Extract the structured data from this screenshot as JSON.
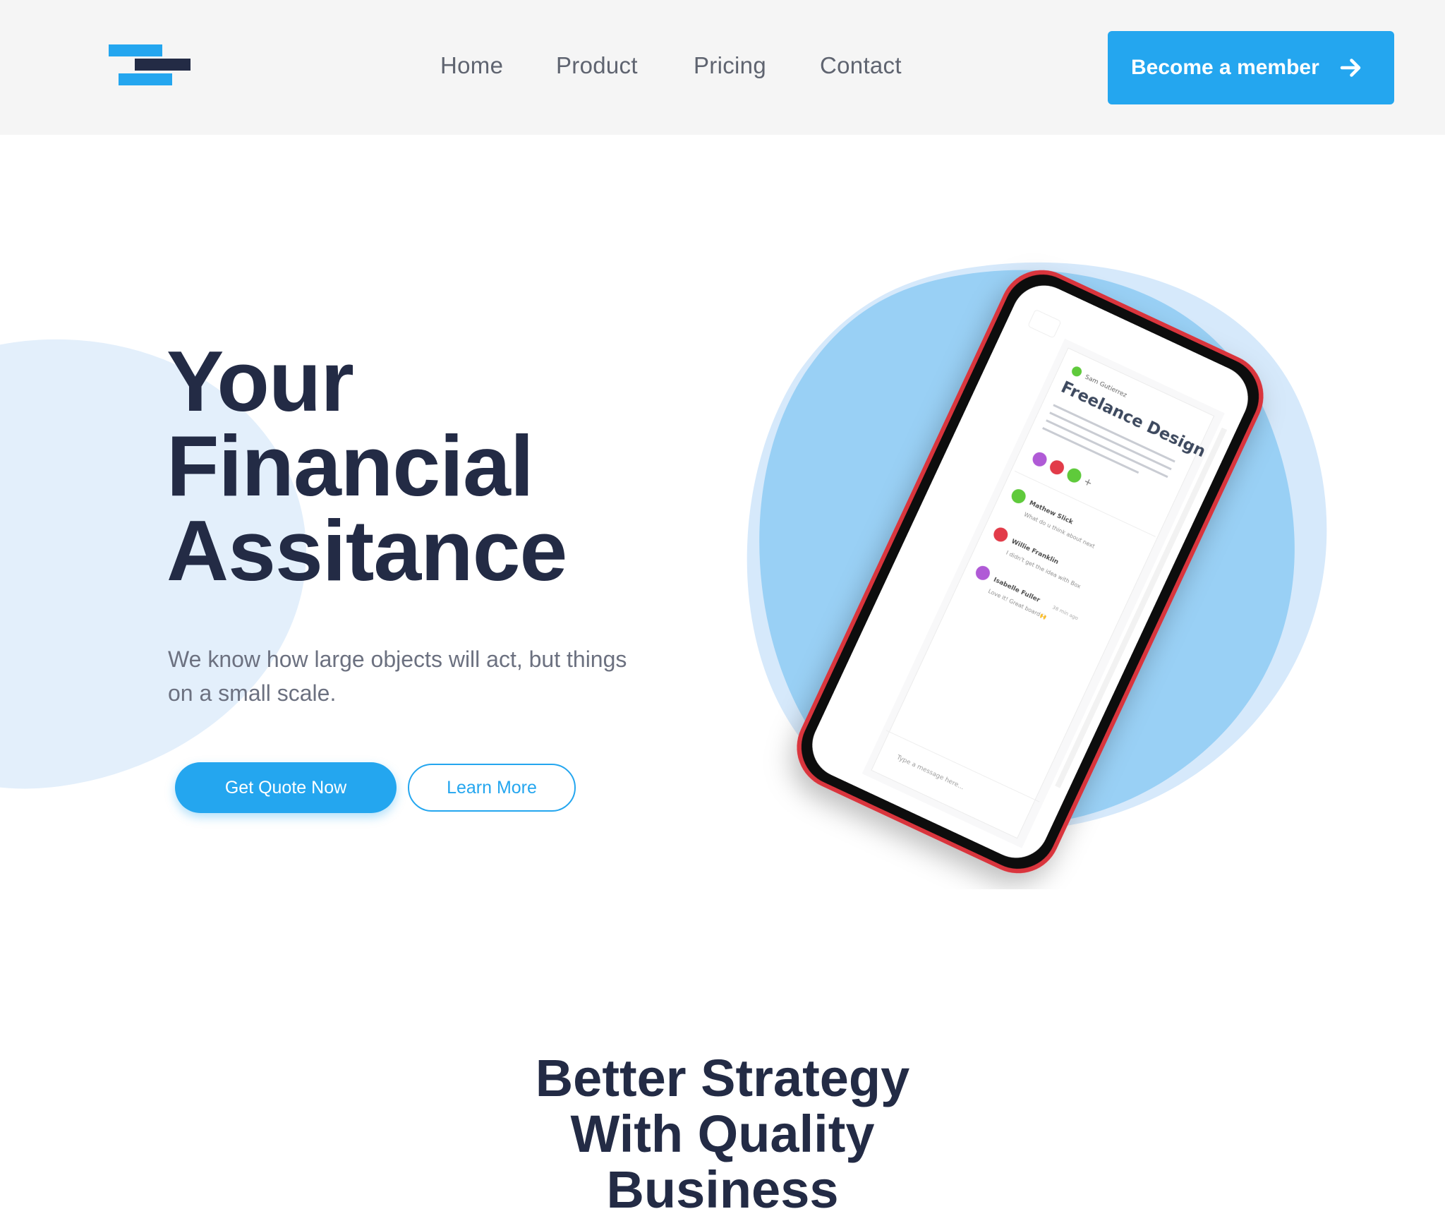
{
  "header": {
    "logo": "logo-mark",
    "nav": [
      "Home",
      "Product",
      "Pricing",
      "Contact"
    ],
    "cta_label": "Become a member",
    "cta_icon": "arrow-right-icon"
  },
  "hero": {
    "title_lines": [
      "Your",
      "Financial",
      "Assitance"
    ],
    "subtitle": "We know how large objects will act, but things on a small scale.",
    "primary_button": "Get Quote Now",
    "secondary_button": "Learn More",
    "phone_screen": {
      "user": "Sam Gutierrez",
      "card_title": "Freelance Design",
      "card_body": "Do you want to download free song for ipod? If so, reading this article could save you from getting in to a lot of trouble! Downloading music to your Ipod has become easy. This article will tell you the best way to download free",
      "comments": [
        {
          "name": "Mathew Slick",
          "text": "What do u think about next"
        },
        {
          "name": "Willie Franklin",
          "text": "I didn't get the idea with Box"
        },
        {
          "name": "Isabelle Fuller",
          "time": "38 min ago",
          "text": "Love it! Great board🙌"
        }
      ],
      "message_placeholder": "Type a message here..."
    }
  },
  "section": {
    "title_lines": [
      "Better Strategy",
      "With Quality",
      "Business"
    ]
  },
  "colors": {
    "accent": "#24a6ef",
    "navy": "#232b45",
    "header_bg": "#f5f5f5",
    "blob_light": "#e3effb",
    "blob_blue": "#99d0f5",
    "phone_frame_red": "#d9363e"
  }
}
